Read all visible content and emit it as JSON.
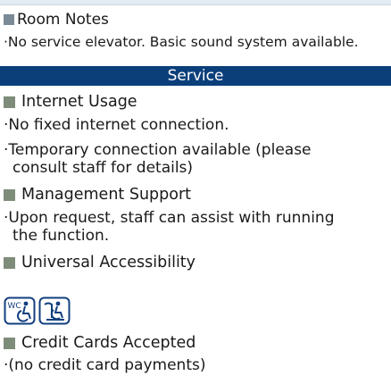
{
  "room_notes": {
    "heading": "Room Notes",
    "text": "·No service elevator.  Basic sound system available."
  },
  "service": {
    "title": "Service"
  },
  "sections": {
    "internet": {
      "heading": "Internet Usage",
      "line1": "·No fixed internet connection.",
      "line2": "·Temporary connection available (please",
      "line3": "consult staff for details)"
    },
    "management": {
      "heading": "Management Support",
      "line1": "·Upon request, staff can assist with running",
      "line2": "the function."
    },
    "accessibility": {
      "heading": "Universal Accessibility",
      "icons": [
        "wheelchair-toilet-icon",
        "wheelchair-access-icon"
      ],
      "icon_text": "WC"
    },
    "credit": {
      "heading": "Credit Cards Accepted",
      "line1": "·(no credit card payments)"
    }
  },
  "colors": {
    "service_band": "#0b3f7a",
    "room_square": "#7a8a96",
    "section_square": "#7e8c7a",
    "icon_stroke": "#123f7f"
  }
}
